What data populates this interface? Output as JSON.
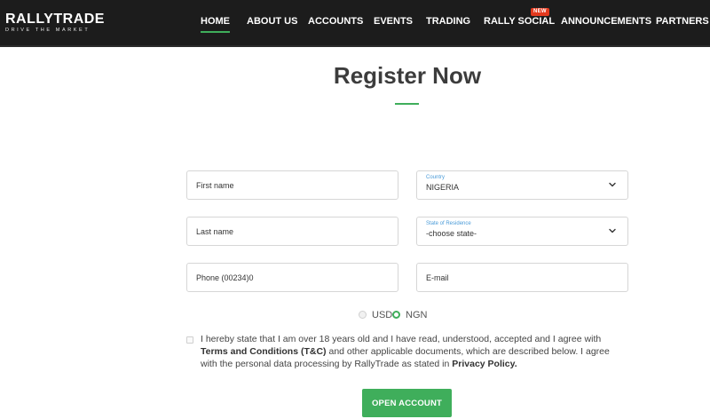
{
  "brand": {
    "name": "RALLYTRADE",
    "tagline": "DRIVE THE MARKET"
  },
  "nav": {
    "items": [
      {
        "label": "HOME",
        "active": true
      },
      {
        "label": "ABOUT US"
      },
      {
        "label": "ACCOUNTS"
      },
      {
        "label": "EVENTS"
      },
      {
        "label": "TRADING"
      },
      {
        "label": "RALLY SOCIAL",
        "badge": "NEW"
      },
      {
        "label": "ANNOUNCEMENTS"
      },
      {
        "label": "PARTNERS"
      }
    ]
  },
  "page": {
    "title": "Register Now"
  },
  "form": {
    "first_name": {
      "placeholder": "First name"
    },
    "last_name": {
      "placeholder": "Last name"
    },
    "phone": {
      "placeholder": "Phone (00234)0"
    },
    "email": {
      "placeholder": "E-mail"
    },
    "country": {
      "label": "Country",
      "value": "NIGERIA"
    },
    "state": {
      "label": "State of Residence",
      "value": "-choose state-"
    },
    "currency": {
      "options": [
        "USD",
        "NGN"
      ],
      "selected": "NGN"
    },
    "terms": {
      "part1": "I hereby state that I am over 18 years old and I have read, understood, accepted and I agree with ",
      "link1": "Terms and Conditions (T&C)",
      "part2": " and other applicable documents, which are described below. I agree with the personal data processing by RallyTrade as stated in ",
      "link2": "Privacy Policy.",
      "checked": false
    },
    "submit_label": "OPEN ACCOUNT"
  },
  "colors": {
    "nav_bg": "#1c1c1c",
    "accent": "#3fae5b",
    "badge": "#e2391e",
    "select_label": "#4a9bd8"
  }
}
